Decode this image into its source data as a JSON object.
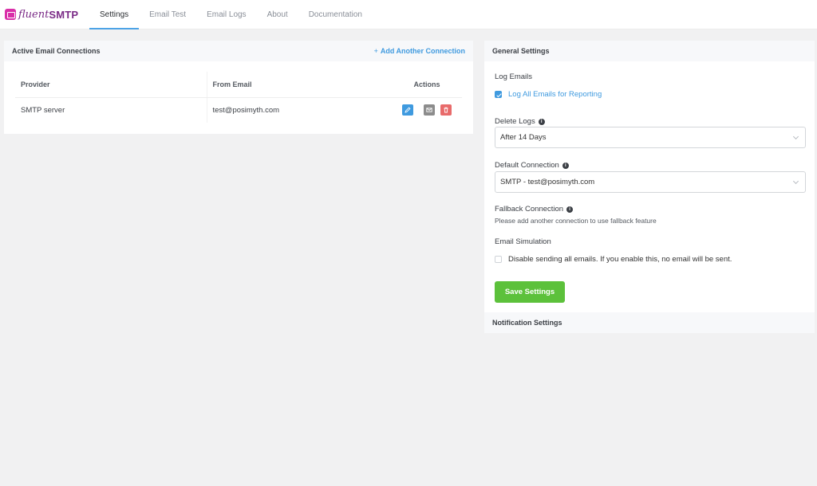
{
  "brand": {
    "part1": "fluent",
    "part2": "SMTP"
  },
  "nav": {
    "tabs": [
      {
        "label": "Settings",
        "active": true
      },
      {
        "label": "Email Test",
        "active": false
      },
      {
        "label": "Email Logs",
        "active": false
      },
      {
        "label": "About",
        "active": false
      },
      {
        "label": "Documentation",
        "active": false
      }
    ]
  },
  "connections": {
    "title": "Active Email Connections",
    "add_link": "Add Another Connection",
    "columns": [
      "Provider",
      "From Email",
      "Actions"
    ],
    "rows": [
      {
        "provider": "SMTP server",
        "from_email": "test@posimyth.com"
      }
    ]
  },
  "general": {
    "title": "General Settings",
    "log_emails_label": "Log Emails",
    "log_all_label": "Log All Emails for Reporting",
    "log_all_checked": true,
    "delete_logs_label": "Delete Logs",
    "delete_logs_value": "After 14 Days",
    "default_connection_label": "Default Connection",
    "default_connection_value": "SMTP - test@posimyth.com",
    "fallback_label": "Fallback Connection",
    "fallback_hint": "Please add another connection to use fallback feature",
    "simulation_label": "Email Simulation",
    "simulation_checkbox_label": "Disable sending all emails. If you enable this, no email will be sent.",
    "simulation_checked": false,
    "save_label": "Save Settings"
  },
  "notification": {
    "title": "Notification Settings"
  },
  "colors": {
    "accent": "#3f9adf",
    "save": "#5cc13b",
    "delete": "#e86b6b",
    "brand": "#7a2a86"
  }
}
